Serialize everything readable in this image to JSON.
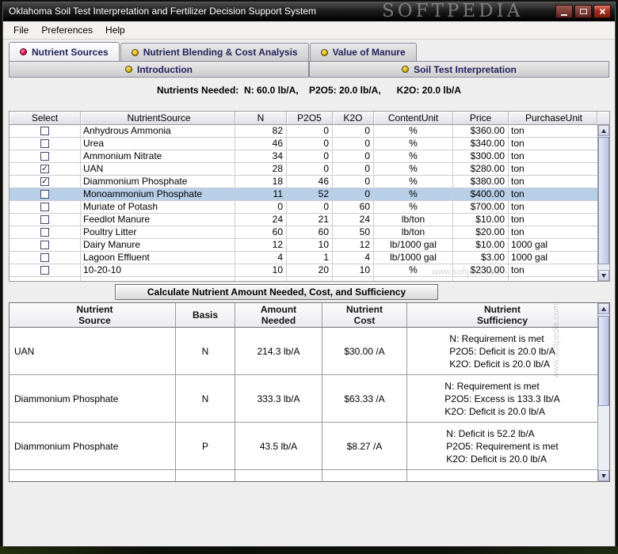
{
  "window": {
    "title": "Oklahoma Soil Test Interpretation and Fertilizer Decision Support System"
  },
  "watermarks": {
    "logo": "SOFTPEDIA",
    "url": "www.softpedia.com"
  },
  "menu": {
    "items": [
      {
        "label": "File"
      },
      {
        "label": "Preferences"
      },
      {
        "label": "Help"
      }
    ]
  },
  "tabs": {
    "row1": [
      {
        "label": "Nutrient Sources",
        "selected": true
      },
      {
        "label": "Nutrient Blending & Cost Analysis",
        "selected": false
      },
      {
        "label": "Value of Manure",
        "selected": false
      }
    ],
    "row2": [
      {
        "label": "Introduction"
      },
      {
        "label": "Soil Test Interpretation"
      }
    ]
  },
  "content": {
    "nutrients_needed": "Nutrients Needed:  N: 60.0 lb/A,    P2O5: 20.0 lb/A,      K2O: 20.0 lb/A"
  },
  "sources_table": {
    "columns": [
      "Select",
      "NutrientSource",
      "N",
      "P2O5",
      "K2O",
      "ContentUnit",
      "Price",
      "PurchaseUnit"
    ],
    "rows": [
      {
        "checked": false,
        "selected": false,
        "name": "Anhydrous Ammonia",
        "n": "82",
        "p2o5": "0",
        "k2o": "0",
        "content_unit": "%",
        "price": "$360.00",
        "purchase_unit": "ton"
      },
      {
        "checked": false,
        "selected": false,
        "name": "Urea",
        "n": "46",
        "p2o5": "0",
        "k2o": "0",
        "content_unit": "%",
        "price": "$340.00",
        "purchase_unit": "ton"
      },
      {
        "checked": false,
        "selected": false,
        "name": "Ammonium Nitrate",
        "n": "34",
        "p2o5": "0",
        "k2o": "0",
        "content_unit": "%",
        "price": "$300.00",
        "purchase_unit": "ton"
      },
      {
        "checked": true,
        "selected": false,
        "name": "UAN",
        "n": "28",
        "p2o5": "0",
        "k2o": "0",
        "content_unit": "%",
        "price": "$280.00",
        "purchase_unit": "ton"
      },
      {
        "checked": true,
        "selected": false,
        "name": "Diammonium Phosphate",
        "n": "18",
        "p2o5": "46",
        "k2o": "0",
        "content_unit": "%",
        "price": "$380.00",
        "purchase_unit": "ton"
      },
      {
        "checked": false,
        "selected": true,
        "name": "Monoammonium Phosphate",
        "n": "11",
        "p2o5": "52",
        "k2o": "0",
        "content_unit": "%",
        "price": "$400.00",
        "purchase_unit": "ton"
      },
      {
        "checked": false,
        "selected": false,
        "name": "Muriate of Potash",
        "n": "0",
        "p2o5": "0",
        "k2o": "60",
        "content_unit": "%",
        "price": "$700.00",
        "purchase_unit": "ton"
      },
      {
        "checked": false,
        "selected": false,
        "name": "Feedlot Manure",
        "n": "24",
        "p2o5": "21",
        "k2o": "24",
        "content_unit": "lb/ton",
        "price": "$10.00",
        "purchase_unit": "ton"
      },
      {
        "checked": false,
        "selected": false,
        "name": "Poultry Litter",
        "n": "60",
        "p2o5": "60",
        "k2o": "50",
        "content_unit": "lb/ton",
        "price": "$20.00",
        "purchase_unit": "ton"
      },
      {
        "checked": false,
        "selected": false,
        "name": "Dairy Manure",
        "n": "12",
        "p2o5": "10",
        "k2o": "12",
        "content_unit": "lb/1000 gal",
        "price": "$10.00",
        "purchase_unit": "1000 gal"
      },
      {
        "checked": false,
        "selected": false,
        "name": "Lagoon Effluent",
        "n": "4",
        "p2o5": "1",
        "k2o": "4",
        "content_unit": "lb/1000 gal",
        "price": "$3.00",
        "purchase_unit": "1000 gal"
      },
      {
        "checked": false,
        "selected": false,
        "name": "10-20-10",
        "n": "10",
        "p2o5": "20",
        "k2o": "10",
        "content_unit": "%",
        "price": "$230.00",
        "purchase_unit": "ton"
      }
    ]
  },
  "calc": {
    "button_label": "Calculate Nutrient Amount Needed, Cost, and Sufficiency",
    "columns": [
      "Nutrient\nSource",
      "Basis",
      "Amount\nNeeded",
      "Nutrient\nCost",
      "Nutrient\nSufficiency"
    ],
    "rows": [
      {
        "source": "UAN",
        "basis": "N",
        "amount": "214.3 lb/A",
        "cost": "$30.00 /A",
        "sufficiency": "N: Requirement is met\nP2O5: Deficit is 20.0 lb/A\nK2O: Deficit is 20.0 lb/A"
      },
      {
        "source": "Diammonium Phosphate",
        "basis": "N",
        "amount": "333.3 lb/A",
        "cost": "$63.33 /A",
        "sufficiency": "N: Requirement is met\nP2O5: Excess is 133.3 lb/A\nK2O: Deficit is 20.0 lb/A"
      },
      {
        "source": "Diammonium Phosphate",
        "basis": "P",
        "amount": "43.5 lb/A",
        "cost": "$8.27 /A",
        "sufficiency": "N: Deficit is 52.2 lb/A\nP2O5: Requirement is met\nK2O: Deficit is 20.0 lb/A"
      }
    ]
  }
}
